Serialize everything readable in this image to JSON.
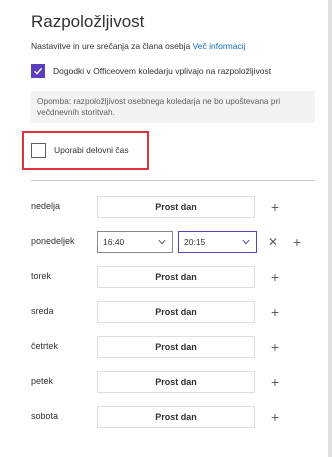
{
  "panel": {
    "title": "Razpoložljivost",
    "subtitle": "Nastavitve in ure srečanja za člana osebja",
    "more_info_link": "Več informacij",
    "office_calendar_checkbox": {
      "label": "Dogodki v Officeovem koledarju vplivajo na razpoložljivost",
      "checked": true
    },
    "note": "Opomba: razpoložljivost osebnega koledarja ne bo upoštevana pri večdnevnih storitvah.",
    "work_hours_checkbox": {
      "label": "Uporabi delovni čas",
      "checked": false
    }
  },
  "days": [
    {
      "label": "nedelja",
      "status": "Prost dan"
    },
    {
      "label": "ponedeljek",
      "start": "16:40",
      "end": "20:15"
    },
    {
      "label": "torek",
      "status": "Prost dan"
    },
    {
      "label": "sreda",
      "status": "Prost dan"
    },
    {
      "label": "četrtek",
      "status": "Prost dan"
    },
    {
      "label": "petek",
      "status": "Prost dan"
    },
    {
      "label": "sobota",
      "status": "Prost dan"
    }
  ],
  "icons": {
    "add": "plus-icon",
    "remove": "close-icon",
    "dropdown": "chevron-down-icon",
    "check": "checkmark-icon"
  },
  "colors": {
    "accent": "#5b3fbf",
    "highlight_border": "#e0323c",
    "link": "#0f6cbd"
  }
}
